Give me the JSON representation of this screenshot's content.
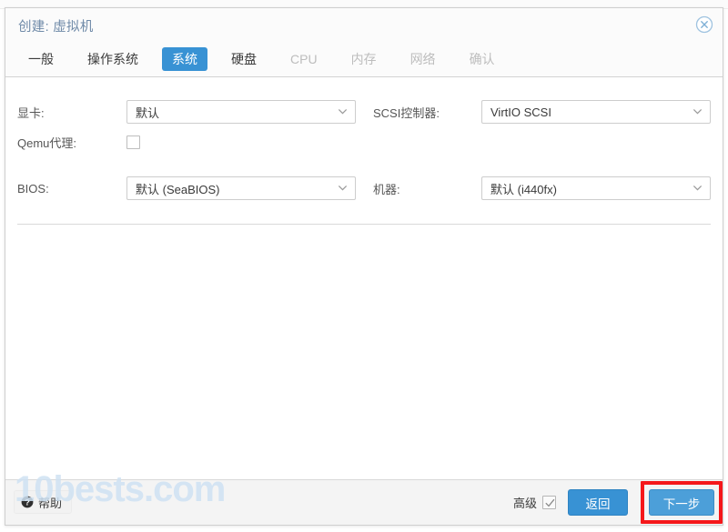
{
  "dialog": {
    "title": "创建: 虚拟机",
    "close_icon": "close-circle-icon"
  },
  "tabs": [
    {
      "label": "一般",
      "state": "normal"
    },
    {
      "label": "操作系统",
      "state": "normal"
    },
    {
      "label": "系统",
      "state": "active"
    },
    {
      "label": "硬盘",
      "state": "normal"
    },
    {
      "label": "CPU",
      "state": "disabled"
    },
    {
      "label": "内存",
      "state": "disabled"
    },
    {
      "label": "网络",
      "state": "disabled"
    },
    {
      "label": "确认",
      "state": "disabled"
    }
  ],
  "form": {
    "graphic_card": {
      "label": "显卡:",
      "value": "默认"
    },
    "qemu_agent": {
      "label": "Qemu代理:",
      "checked": false
    },
    "scsi_controller": {
      "label": "SCSI控制器:",
      "value": "VirtIO SCSI"
    },
    "bios": {
      "label": "BIOS:",
      "value": "默认 (SeaBIOS)"
    },
    "machine": {
      "label": "机器:",
      "value": "默认 (i440fx)"
    }
  },
  "footer": {
    "help_label": "帮助",
    "help_icon": "question-mark-icon",
    "advanced_label": "高级",
    "advanced_checked": true,
    "back_label": "返回",
    "next_label": "下一步"
  },
  "watermark": {
    "text": "10bests.com"
  },
  "colors": {
    "accent": "#3892d4",
    "highlight": "#f5171a",
    "title": "#6f8aa8",
    "disabled_tab": "#bdbdbd"
  }
}
